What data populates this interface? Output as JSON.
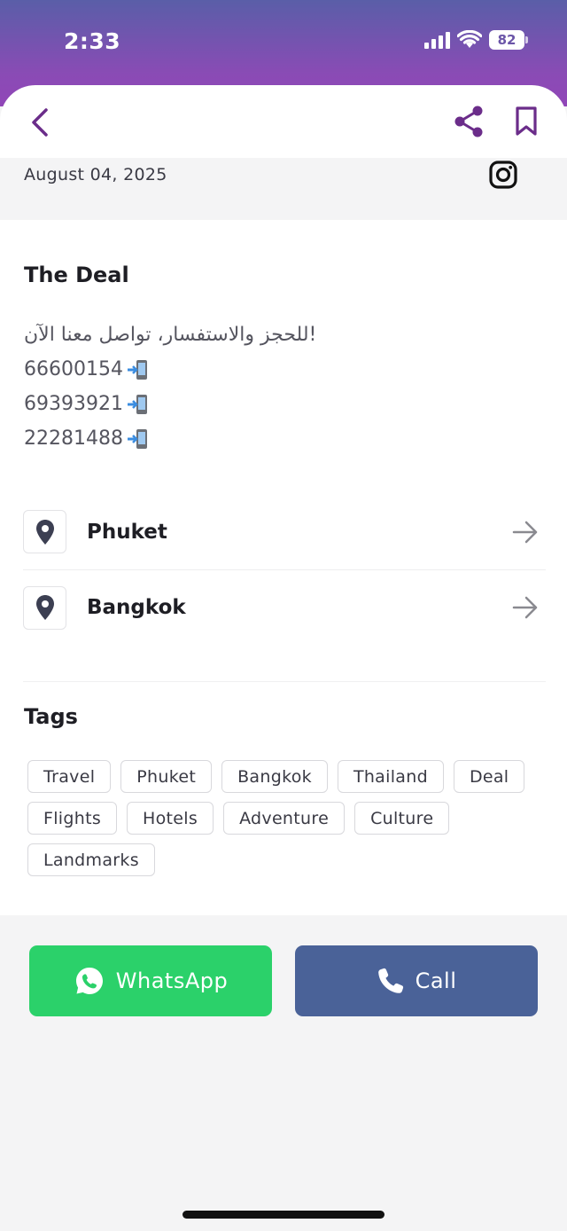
{
  "status_bar": {
    "time": "2:33",
    "battery": "82"
  },
  "header": {
    "icons": [
      "back-icon",
      "share-icon",
      "bookmark-icon"
    ]
  },
  "meta": {
    "date": "August 04, 2025",
    "social_icon": "instagram-icon"
  },
  "deal": {
    "title": "The Deal",
    "intro": "!للحجز والاستفسار، تواصل معنا الآن",
    "phones": [
      "66600154",
      "69393921",
      "22281488"
    ]
  },
  "locations": [
    {
      "name": "Phuket"
    },
    {
      "name": "Bangkok"
    }
  ],
  "tags_section": {
    "title": "Tags",
    "rows": [
      [
        "Travel",
        "Phuket",
        "Bangkok",
        "Thailand",
        "Deal"
      ],
      [
        "Flights",
        "Hotels",
        "Adventure",
        "Culture"
      ],
      [
        "Landmarks"
      ]
    ]
  },
  "actions": {
    "whatsapp_label": "WhatsApp",
    "call_label": "Call"
  },
  "colors": {
    "status_gradient_top": "#5a5ea8",
    "status_gradient_bottom": "#9146b8",
    "accent_purple": "#6b2d8a",
    "whatsapp_green": "#2bd16a",
    "call_blue": "#4a6298"
  }
}
